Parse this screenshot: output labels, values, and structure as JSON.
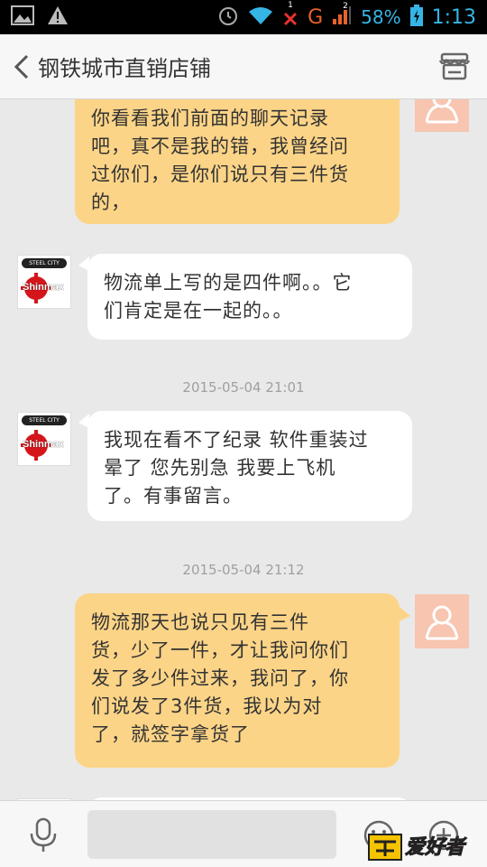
{
  "status_bar": {
    "battery_percent": "58%",
    "time": "1:13",
    "network_label": "G",
    "sim1": "1",
    "sim2": "2"
  },
  "header": {
    "title": "钢铁城市直销店铺",
    "back_icon": "chevron-left-icon",
    "store_icon": "store-icon"
  },
  "shop_avatar": {
    "top_label": "STEEL CITY",
    "brand": "Shinmax"
  },
  "messages": [
    {
      "side": "right",
      "lines": [
        "你看看我们前面的聊天记录",
        "吧，真不是我的错，我曾经问",
        "过你们，是你们说只有三件货",
        "的，"
      ]
    },
    {
      "side": "left",
      "lines": [
        "物流单上写的是四件啊。。它",
        "们肯定是在一起的。。"
      ]
    },
    {
      "timestamp": "2015-05-04 21:01"
    },
    {
      "side": "left",
      "lines": [
        "我现在看不了纪录 软件重装过",
        "晕了 您先别急 我要上飞机",
        "了。有事留言。"
      ]
    },
    {
      "timestamp": "2015-05-04 21:12"
    },
    {
      "side": "right",
      "lines": [
        "物流那天也说只见有三件",
        "货，少了一件，才让我问你们",
        "发了多少件过来，我问了，你",
        "们说发了3件货，我以为对",
        "了，就签字拿货了"
      ]
    }
  ],
  "input_bar": {
    "placeholder": "",
    "mic_icon": "microphone-icon",
    "emoji_icon": "emoji-icon",
    "plus_icon": "plus-icon"
  },
  "watermark": {
    "text": "爱好者"
  },
  "colors": {
    "bubble_right": "#fcd487",
    "bubble_left": "#ffffff",
    "background": "#e9e9e9",
    "user_avatar": "#f7c5b0",
    "status_icons": "#35b5e5"
  }
}
